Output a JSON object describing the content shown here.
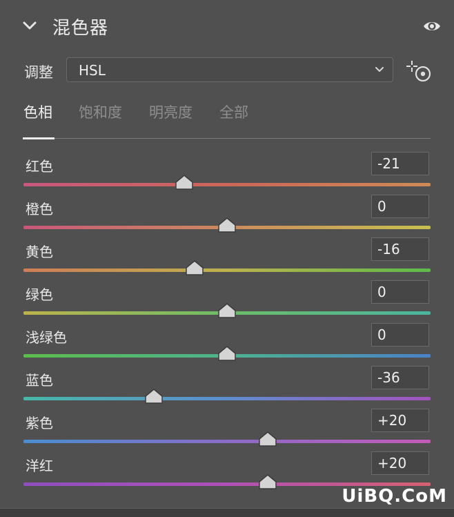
{
  "panel": {
    "title": "混色器",
    "adjust_label": "调整",
    "adjust_value": "HSL"
  },
  "tabs": [
    {
      "label": "色相",
      "active": true
    },
    {
      "label": "饱和度",
      "active": false
    },
    {
      "label": "明亮度",
      "active": false
    },
    {
      "label": "全部",
      "active": false
    }
  ],
  "slider_range": [
    -100,
    100
  ],
  "sliders": [
    {
      "label": "红色",
      "value": "-21",
      "num": -21
    },
    {
      "label": "橙色",
      "value": "0",
      "num": 0
    },
    {
      "label": "黄色",
      "value": "-16",
      "num": -16
    },
    {
      "label": "绿色",
      "value": "0",
      "num": 0
    },
    {
      "label": "浅绿色",
      "value": "0",
      "num": 0
    },
    {
      "label": "蓝色",
      "value": "-36",
      "num": -36
    },
    {
      "label": "紫色",
      "value": "+20",
      "num": 20
    },
    {
      "label": "洋红",
      "value": "+20",
      "num": 20
    }
  ],
  "track_gradients": [
    [
      "#c9587e",
      "#cc6658",
      "#d08a56"
    ],
    [
      "#c9577a",
      "#cc8a5e",
      "#c8c04e"
    ],
    [
      "#cf7d57",
      "#bdb14e",
      "#5cbb4a"
    ],
    [
      "#bcb34c",
      "#6dbd67",
      "#4ab5a0"
    ],
    [
      "#5cbd4c",
      "#4cb38f",
      "#4a82c9"
    ],
    [
      "#47b8a8",
      "#5d8ed0",
      "#a552c0"
    ],
    [
      "#4a8fd0",
      "#8a6cc8",
      "#c45ab8"
    ],
    [
      "#8f4fc0",
      "#b050b8",
      "#d66070"
    ]
  ],
  "watermark": "UiBQ.CoM"
}
